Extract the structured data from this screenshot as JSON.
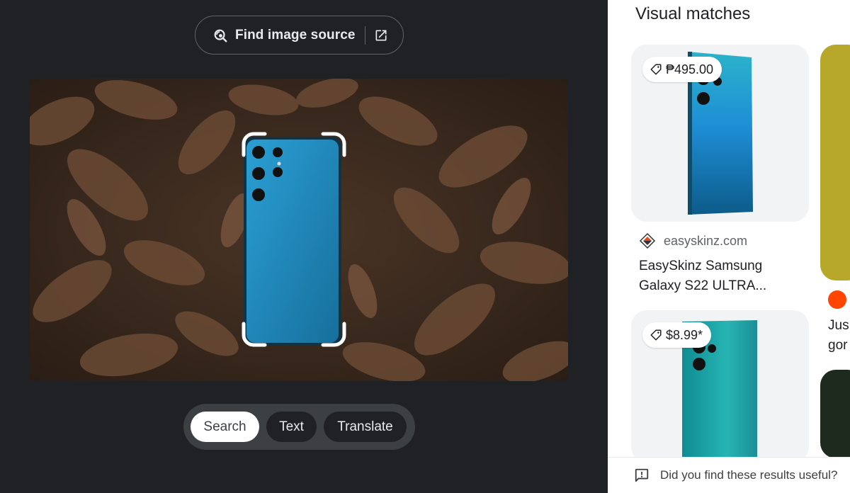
{
  "left_panel": {
    "find_source_label": "Find image source",
    "modes": [
      {
        "label": "Search",
        "active": true
      },
      {
        "label": "Text",
        "active": false
      },
      {
        "label": "Translate",
        "active": false
      }
    ]
  },
  "right_panel": {
    "title": "Visual matches",
    "results": [
      {
        "price": "₱495.00",
        "source": "easyskinz.com",
        "title_line1": "EasySkinz Samsung",
        "title_line2": "Galaxy S22 ULTRA..."
      },
      {
        "price": "$8.99*"
      }
    ],
    "peek_text_line1": "Jus",
    "peek_text_line2": "gor",
    "feedback_text": "Did you find these results useful?"
  },
  "colors": {
    "dark_bg": "#202124",
    "phone_blue": "#1f8fc2",
    "teal_phone": "#1ba3a8"
  },
  "icons": [
    "lens-search-icon",
    "open-in-new-icon",
    "price-tag-icon",
    "easyskinz-favicon",
    "reddit-icon",
    "feedback-icon"
  ]
}
